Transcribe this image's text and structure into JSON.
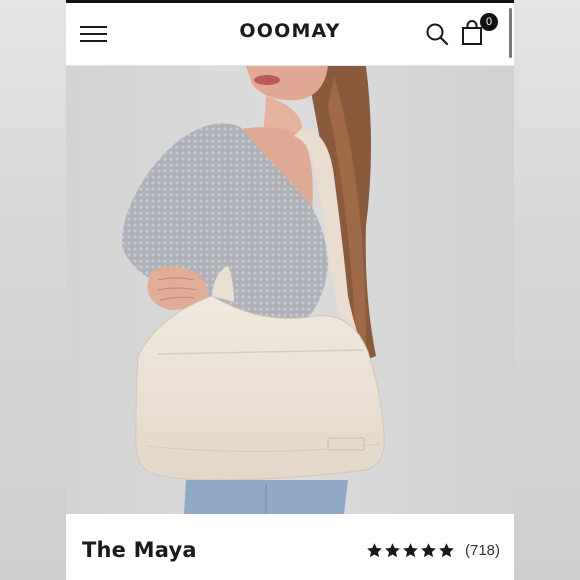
{
  "header": {
    "logo": "OOOMAY",
    "cart_count": "0",
    "icons": {
      "menu": "hamburger-menu-icon",
      "search": "search-icon",
      "cart": "shopping-bag-icon"
    }
  },
  "product": {
    "name": "The Maya",
    "rating": 5,
    "rating_max": 5,
    "review_count": "(718)",
    "image": "woman-carrying-cream-leather-shoulder-bag"
  },
  "colors": {
    "accent": "#111111",
    "bag": "#ece3d6",
    "sweater": "#aeb2b8",
    "background": "#d6d6d6"
  }
}
